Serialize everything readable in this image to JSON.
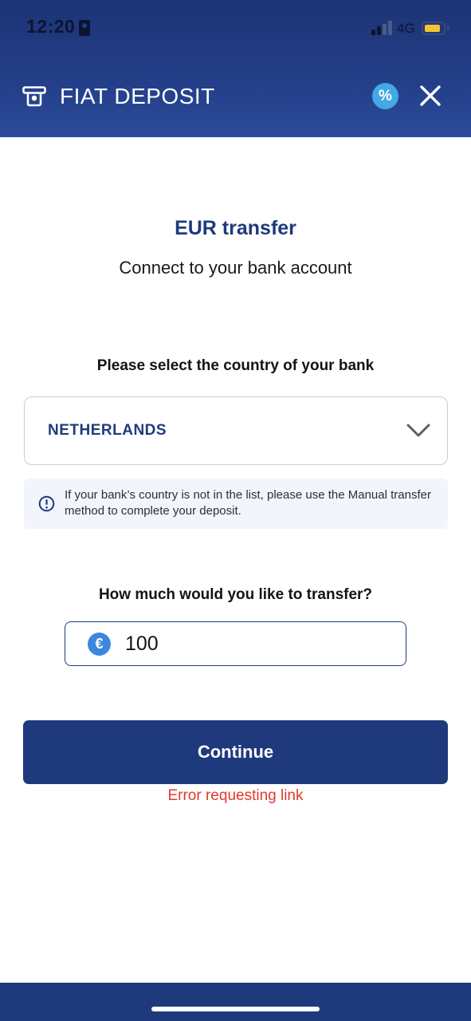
{
  "status_bar": {
    "time": "12:20",
    "network": "4G",
    "battery_level": 0.85,
    "icons": [
      "id-badge-icon",
      "signal-icon",
      "battery-icon"
    ]
  },
  "header": {
    "title": "FIAT DEPOSIT",
    "promo_symbol": "%",
    "icons": [
      "deposit-icon",
      "percent-icon",
      "close-icon"
    ]
  },
  "main": {
    "title": "EUR transfer",
    "subtitle": "Connect to your bank account",
    "country_label": "Please select the country of your bank",
    "country_selected": "NETHERLANDS",
    "info_text": "If your bank’s country is not in the list, please use the Manual transfer method to complete your deposit.",
    "amount_label": "How much would you like to transfer?",
    "currency_symbol": "€",
    "amount_value": "100",
    "continue_label": "Continue",
    "error_text": "Error requesting link"
  },
  "colors": {
    "brand_navy": "#1e3a7c",
    "header_gradient_top": "#1c3375",
    "accent_blue": "#3d86e0",
    "promo_cyan": "#43a9e6",
    "error_red": "#e03a2c",
    "info_bg": "#f2f5fc"
  }
}
